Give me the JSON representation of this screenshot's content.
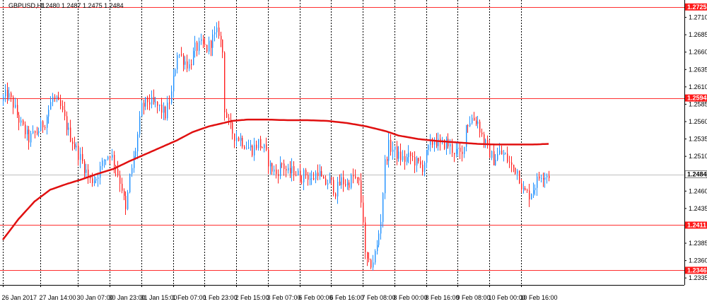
{
  "header": {
    "symbol_label": "GBPUSD,H1",
    "ohlc_label": "1.2480 1.2487 1.2475 1.2484"
  },
  "colors": {
    "background": "#ffffff",
    "bull": "#1e90ff",
    "bear": "#ff2020",
    "ma": "#e01010",
    "hline": "#ff3030",
    "grid": "#000000",
    "price_label_bg": "#ff1a1a",
    "current_line": "#bfbfbf"
  },
  "chart_data": {
    "type": "candlestick",
    "ylim": [
      1.2325,
      1.2735
    ],
    "y_ticks": [
      "1.2710",
      "1.2685",
      "1.2660",
      "1.2635",
      "1.2610",
      "1.2585",
      "1.2560",
      "1.2535",
      "1.2510",
      "1.2460",
      "1.2435",
      "1.2385",
      "1.2360",
      "1.2335"
    ],
    "x_ticks": [
      {
        "label": "26 Jan 2017",
        "bar": 0
      },
      {
        "label": "27 Jan 14:00",
        "bar": 19
      },
      {
        "label": "30 Jan 07:00",
        "bar": 38
      },
      {
        "label": "30 Jan 23:00",
        "bar": 54
      },
      {
        "label": "31 Jan 15:00",
        "bar": 70
      },
      {
        "label": "1 Feb 07:00",
        "bar": 86
      },
      {
        "label": "1 Feb 23:00",
        "bar": 102
      },
      {
        "label": "2 Feb 15:00",
        "bar": 118
      },
      {
        "label": "3 Feb 07:00",
        "bar": 134
      },
      {
        "label": "6 Feb 00:00",
        "bar": 150
      },
      {
        "label": "6 Feb 16:00",
        "bar": 166
      },
      {
        "label": "7 Feb 08:00",
        "bar": 182
      },
      {
        "label": "8 Feb 00:00",
        "bar": 198
      },
      {
        "label": "8 Feb 16:00",
        "bar": 214
      },
      {
        "label": "9 Feb 08:00",
        "bar": 230
      },
      {
        "label": "10 Feb 00:00",
        "bar": 246
      },
      {
        "label": "10 Feb 16:00",
        "bar": 262
      }
    ],
    "horizontal_levels": [
      {
        "label": "1.2725",
        "value": 1.2725
      },
      {
        "label": "1.2594",
        "value": 1.2594
      },
      {
        "label": "1.2411",
        "value": 1.2411
      },
      {
        "label": "1.2346",
        "value": 1.2346
      }
    ],
    "current_price": {
      "label": "1.2484",
      "value": 1.2484
    },
    "keypoints": [
      [
        0,
        1.259
      ],
      [
        3,
        1.26
      ],
      [
        6,
        1.2585
      ],
      [
        10,
        1.2555
      ],
      [
        14,
        1.2535
      ],
      [
        18,
        1.2545
      ],
      [
        22,
        1.256
      ],
      [
        26,
        1.2595
      ],
      [
        30,
        1.258
      ],
      [
        34,
        1.2545
      ],
      [
        38,
        1.252
      ],
      [
        42,
        1.2495
      ],
      [
        45,
        1.2475
      ],
      [
        48,
        1.248
      ],
      [
        52,
        1.2505
      ],
      [
        55,
        1.2515
      ],
      [
        58,
        1.2495
      ],
      [
        61,
        1.2465
      ],
      [
        63,
        1.243
      ],
      [
        65,
        1.248
      ],
      [
        68,
        1.252
      ],
      [
        71,
        1.258
      ],
      [
        74,
        1.259
      ],
      [
        77,
        1.2585
      ],
      [
        80,
        1.258
      ],
      [
        83,
        1.257
      ],
      [
        86,
        1.26
      ],
      [
        89,
        1.266
      ],
      [
        92,
        1.265
      ],
      [
        95,
        1.264
      ],
      [
        98,
        1.2665
      ],
      [
        101,
        1.267
      ],
      [
        104,
        1.2665
      ],
      [
        107,
        1.268
      ],
      [
        110,
        1.269
      ],
      [
        112,
        1.266
      ],
      [
        113,
        1.258
      ],
      [
        115,
        1.2555
      ],
      [
        118,
        1.254
      ],
      [
        121,
        1.2535
      ],
      [
        124,
        1.2525
      ],
      [
        127,
        1.252
      ],
      [
        130,
        1.253
      ],
      [
        133,
        1.252
      ],
      [
        136,
        1.2495
      ],
      [
        139,
        1.2485
      ],
      [
        142,
        1.25
      ],
      [
        145,
        1.2485
      ],
      [
        148,
        1.249
      ],
      [
        151,
        1.248
      ],
      [
        154,
        1.2485
      ],
      [
        157,
        1.2475
      ],
      [
        160,
        1.249
      ],
      [
        163,
        1.247
      ],
      [
        166,
        1.2475
      ],
      [
        169,
        1.246
      ],
      [
        172,
        1.2475
      ],
      [
        175,
        1.247
      ],
      [
        178,
        1.248
      ],
      [
        181,
        1.247
      ],
      [
        183,
        1.242
      ],
      [
        184,
        1.2365
      ],
      [
        186,
        1.2352
      ],
      [
        188,
        1.236
      ],
      [
        190,
        1.238
      ],
      [
        192,
        1.242
      ],
      [
        194,
        1.25
      ],
      [
        196,
        1.2525
      ],
      [
        198,
        1.252
      ],
      [
        201,
        1.251
      ],
      [
        204,
        1.2505
      ],
      [
        207,
        1.251
      ],
      [
        210,
        1.25
      ],
      [
        213,
        1.2495
      ],
      [
        216,
        1.252
      ],
      [
        219,
        1.2535
      ],
      [
        222,
        1.2525
      ],
      [
        225,
        1.253
      ],
      [
        228,
        1.252
      ],
      [
        231,
        1.2515
      ],
      [
        233,
        1.251
      ],
      [
        235,
        1.2555
      ],
      [
        238,
        1.2565
      ],
      [
        241,
        1.256
      ],
      [
        243,
        1.254
      ],
      [
        246,
        1.252
      ],
      [
        249,
        1.2505
      ],
      [
        252,
        1.2515
      ],
      [
        255,
        1.251
      ],
      [
        258,
        1.2495
      ],
      [
        261,
        1.249
      ],
      [
        264,
        1.246
      ],
      [
        267,
        1.2455
      ],
      [
        270,
        1.247
      ],
      [
        273,
        1.2485
      ],
      [
        276,
        1.2484
      ]
    ],
    "ma_points": [
      [
        0,
        1.239
      ],
      [
        8,
        1.242
      ],
      [
        16,
        1.2445
      ],
      [
        24,
        1.2462
      ],
      [
        32,
        1.247
      ],
      [
        40,
        1.2477
      ],
      [
        48,
        1.2485
      ],
      [
        56,
        1.2492
      ],
      [
        64,
        1.2503
      ],
      [
        72,
        1.2513
      ],
      [
        80,
        1.2523
      ],
      [
        88,
        1.2533
      ],
      [
        96,
        1.2545
      ],
      [
        104,
        1.2553
      ],
      [
        110,
        1.2557
      ],
      [
        116,
        1.2561
      ],
      [
        124,
        1.2563
      ],
      [
        134,
        1.2563
      ],
      [
        144,
        1.2562
      ],
      [
        154,
        1.2562
      ],
      [
        164,
        1.2561
      ],
      [
        174,
        1.2558
      ],
      [
        184,
        1.2553
      ],
      [
        194,
        1.2546
      ],
      [
        200,
        1.254
      ],
      [
        210,
        1.2535
      ],
      [
        220,
        1.2532
      ],
      [
        230,
        1.253
      ],
      [
        240,
        1.2528
      ],
      [
        250,
        1.2527
      ],
      [
        260,
        1.2527
      ],
      [
        268,
        1.2527
      ],
      [
        276,
        1.2528
      ]
    ],
    "total_bars": 277
  }
}
